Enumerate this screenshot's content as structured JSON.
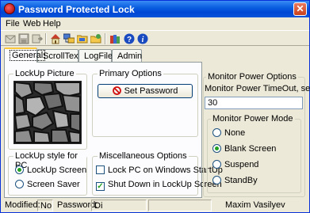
{
  "window": {
    "title": "Password Protected Lock",
    "close_glyph": "✕"
  },
  "menu": [
    "File",
    "Web",
    "Help"
  ],
  "toolbar": {
    "icons": [
      "mail-icon",
      "save-icon",
      "export-icon",
      "home-icon",
      "network-icon",
      "folder-icon",
      "books-icon",
      "help-icon",
      "info-icon"
    ]
  },
  "tabs": [
    "General",
    "ScrollText",
    "LogFile",
    "Admin"
  ],
  "general": {
    "lockup_picture_label": "LockUp Picture",
    "primary_options_label": "Primary Options",
    "set_password_label": "Set Password",
    "lockup_style_label": "LockUp style for PC",
    "lockup_style_options": [
      {
        "label": "LockUp Screen",
        "selected": true
      },
      {
        "label": "Screen Saver",
        "selected": false
      }
    ],
    "misc_label": "Miscellaneous Options",
    "misc_options": [
      {
        "label": "Lock PC on Windows StartUp",
        "checked": false
      },
      {
        "label": "Shut Down in LockUp Screen",
        "checked": true
      }
    ]
  },
  "monitor": {
    "group_label": "Monitor Power Options",
    "timeout_label": "Monitor Power TimeOut, secs:",
    "timeout_value": "30",
    "mode_label": "Monitor Power Mode",
    "modes": [
      {
        "label": "None",
        "selected": false
      },
      {
        "label": "Blank Screen",
        "selected": true
      },
      {
        "label": "Suspend",
        "selected": false
      },
      {
        "label": "StandBy",
        "selected": false
      }
    ]
  },
  "status": {
    "modified_label": "Modified:",
    "modified_value": "No",
    "password_label": "Password:",
    "password_value": "Di",
    "author": "Maxim Vasilyev"
  },
  "colors": {
    "title_blue": "#0046d5",
    "face": "#ece9d8",
    "tab_highlight": "#ffc83c"
  }
}
